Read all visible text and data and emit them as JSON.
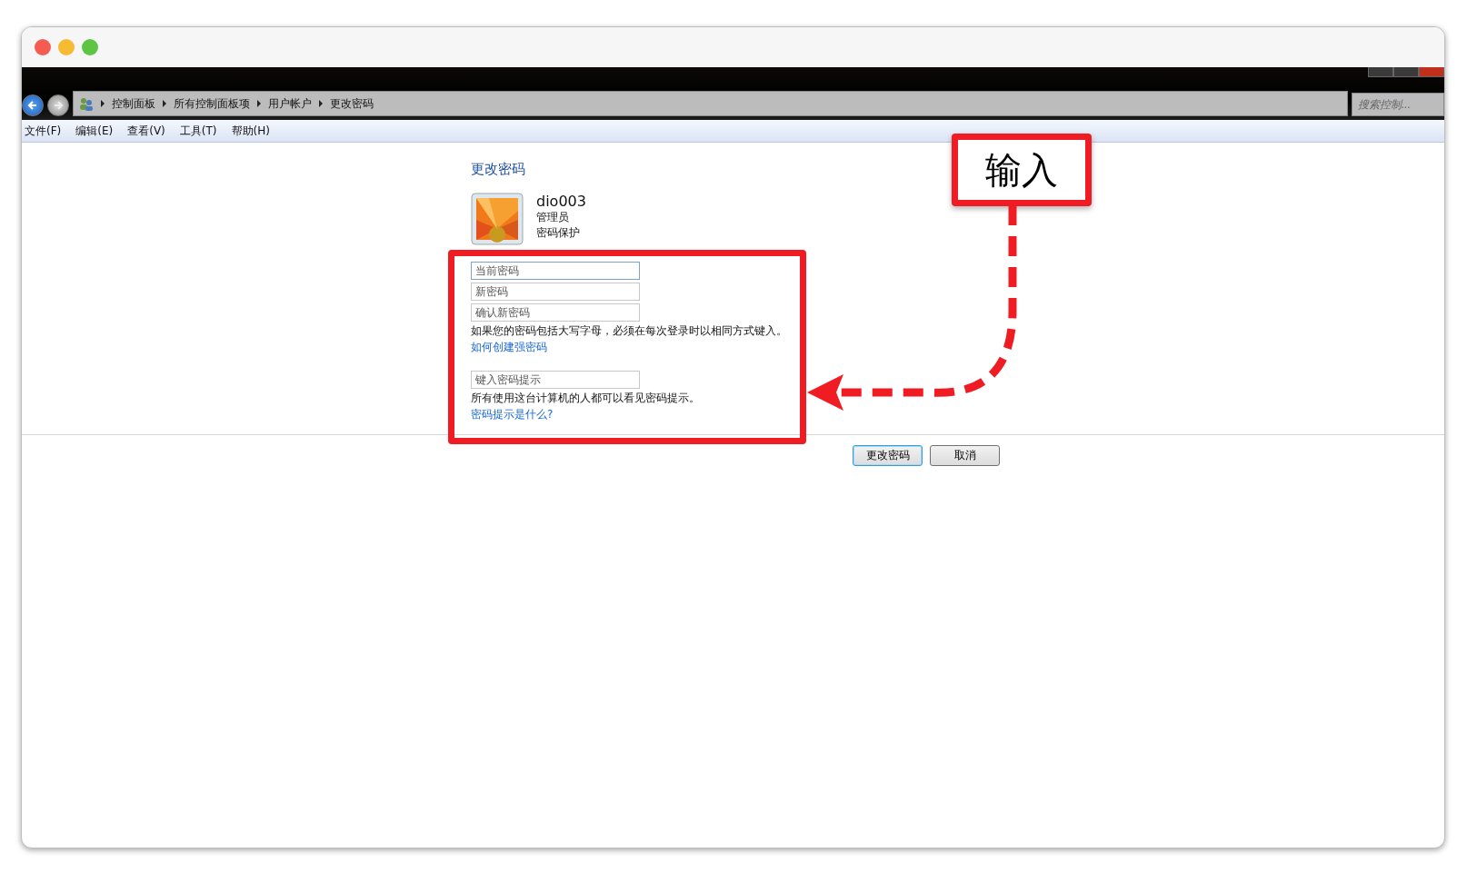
{
  "breadcrumb": [
    {
      "label": "控制面板"
    },
    {
      "label": "所有控制面板项"
    },
    {
      "label": "用户帐户"
    },
    {
      "label": "更改密码"
    }
  ],
  "search": {
    "placeholder": "搜索控制..."
  },
  "menu": [
    {
      "label": "文件(F)"
    },
    {
      "label": "编辑(E)"
    },
    {
      "label": "查看(V)"
    },
    {
      "label": "工具(T)"
    },
    {
      "label": "帮助(H)"
    }
  ],
  "page": {
    "title": "更改密码",
    "user": {
      "name": "dio003",
      "role": "管理员",
      "status": "密码保护"
    },
    "fields": [
      {
        "placeholder": "当前密码",
        "focused": true
      },
      {
        "placeholder": "新密码",
        "focused": false
      },
      {
        "placeholder": "确认新密码",
        "focused": false
      }
    ],
    "note": "如果您的密码包括大写字母，必须在每次登录时以相同方式键入。",
    "link": "如何创建强密码",
    "hint_field": {
      "placeholder": "键入密码提示"
    },
    "hint_note": "所有使用这台计算机的人都可以看见密码提示。",
    "hint_link": "密码提示是什么?"
  },
  "buttons": [
    {
      "label": "更改密码",
      "default": true
    },
    {
      "label": "取消",
      "default": false
    }
  ],
  "annotation": {
    "label": "输入"
  }
}
